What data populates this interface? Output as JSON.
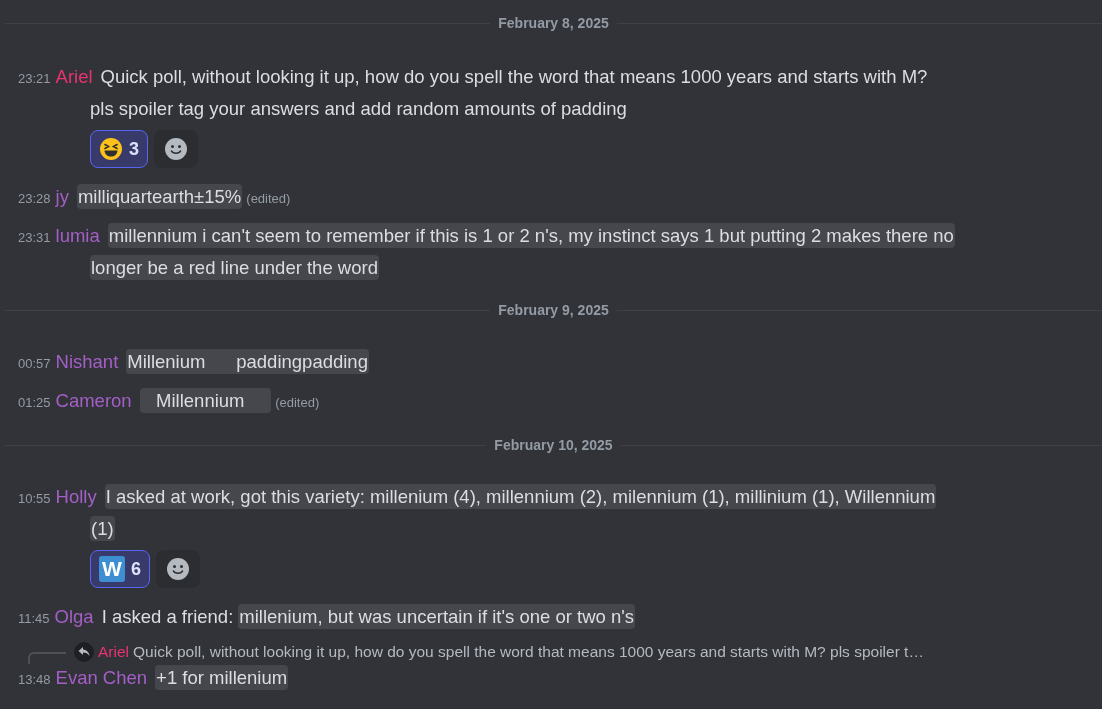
{
  "feed": [
    {
      "kind": "divider",
      "date": "February 8, 2025"
    },
    {
      "kind": "message",
      "time": "23:21",
      "author": "Ariel",
      "color": "#e8336e",
      "lines": [
        [
          {
            "text": "Quick poll, without looking it up, how do you spell the word that means 1000 years and starts with M?",
            "spoiler": false
          }
        ],
        [
          {
            "text": "pls spoiler tag your answers and add random amounts of padding",
            "spoiler": false
          }
        ]
      ],
      "reactions": [
        {
          "kind": "laughing-emoji",
          "count": "3",
          "selected": true
        }
      ]
    },
    {
      "kind": "message",
      "time": "23:28",
      "author": "jy",
      "color": "#a45fc6",
      "lines": [
        [
          {
            "text": "milliquartearth±15%",
            "spoiler": true
          }
        ]
      ],
      "edited": "(edited)"
    },
    {
      "kind": "message",
      "time": "23:31",
      "author": "lumia",
      "color": "#a45fc6",
      "lines": [
        [
          {
            "text": "millennium i can't seem to remember if this is 1 or 2 n's, my instinct says 1 but putting 2 makes there no",
            "spoiler": true
          }
        ],
        [
          {
            "text": "longer be a red line under the word",
            "spoiler": true
          }
        ]
      ]
    },
    {
      "kind": "divider",
      "date": "February 9, 2025"
    },
    {
      "kind": "message",
      "time": "00:57",
      "author": "Nishant",
      "color": "#a45fc6",
      "lines": [
        [
          {
            "text": "Millenium      paddingpadding",
            "spoiler": true
          }
        ]
      ]
    },
    {
      "kind": "message",
      "time": "01:25",
      "author": "Cameron",
      "color": "#a45fc6",
      "lines": [
        [
          {
            "text": "   Millennium     ",
            "spoiler": true
          }
        ]
      ],
      "edited": "(edited)"
    },
    {
      "kind": "divider",
      "date": "February 10, 2025"
    },
    {
      "kind": "message",
      "time": "10:55",
      "author": "Holly",
      "color": "#a45fc6",
      "lines": [
        [
          {
            "text": "I asked at work, got this variety: millenium (4), millennium (2), milennium (1), millinium (1), Willennium",
            "spoiler": true
          }
        ],
        [
          {
            "text": "(1)",
            "spoiler": true
          }
        ]
      ],
      "reactions": [
        {
          "kind": "letter-emoji",
          "label": "W",
          "count": "6",
          "selected": true
        }
      ]
    },
    {
      "kind": "message",
      "time": "11:45",
      "author": "Olga",
      "color": "#a45fc6",
      "lines": [
        [
          {
            "text": "I asked a friend:",
            "spoiler": false
          },
          {
            "text": "millenium, but was uncertain if it's one or two n's",
            "spoiler": true
          }
        ]
      ]
    },
    {
      "kind": "message",
      "time": "13:48",
      "author": "Evan Chen",
      "color": "#a45fc6",
      "reply": {
        "author": "Ariel",
        "color": "#e8336e",
        "text": "Quick poll, without looking it up, how do you spell the word that means 1000 years and starts with M? pls spoiler t…"
      },
      "lines": [
        [
          {
            "text": "+1 for millenium",
            "spoiler": true
          }
        ]
      ]
    }
  ]
}
